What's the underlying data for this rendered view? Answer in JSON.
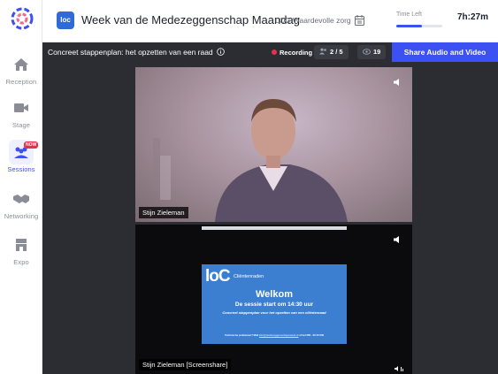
{
  "header": {
    "event_logo_text": "loc",
    "event_title": "Week van de Medezeggenschap Maandag",
    "org_name": "LOC Waardevolle zorg",
    "time_left_label": "Time Left",
    "time_left_value": "7h:27m",
    "time_left_fraction": 0.55
  },
  "sidebar": {
    "items": [
      {
        "label": "Reception",
        "icon": "home-icon"
      },
      {
        "label": "Stage",
        "icon": "camera-icon"
      },
      {
        "label": "Sessions",
        "icon": "people-icon",
        "active": true,
        "badge": "NOW"
      },
      {
        "label": "Networking",
        "icon": "handshake-icon"
      },
      {
        "label": "Expo",
        "icon": "store-icon"
      }
    ]
  },
  "session": {
    "title": "Concreet stappenplan: het opzetten van een raad",
    "recording_label": "Recording",
    "participants": "2 / 5",
    "viewers": "19",
    "share_button": "Share Audio and Video"
  },
  "tiles": [
    {
      "speaker": "Stijn Zieleman"
    },
    {
      "speaker": "Stijn Zieleman [Screenshare]"
    }
  ],
  "slide": {
    "logo": "loC",
    "brand": "Cliëntenraden",
    "heading": "Welkom",
    "start": "De sessie start om 14:30 uur",
    "subtitle": "Concreet stappenplan voor het opzetten van een cliëntenraad",
    "footer_prefix": "Technische problemen? Mail ",
    "footer_link": "info@medezeggenschapsweek.nl",
    "footer_suffix": " of bel 085 - 00 00 000"
  },
  "colors": {
    "accent": "#3d50f2",
    "recording": "#e5314e",
    "stage_bg": "#2b2d33",
    "slide_bg": "#3c7fd0"
  }
}
